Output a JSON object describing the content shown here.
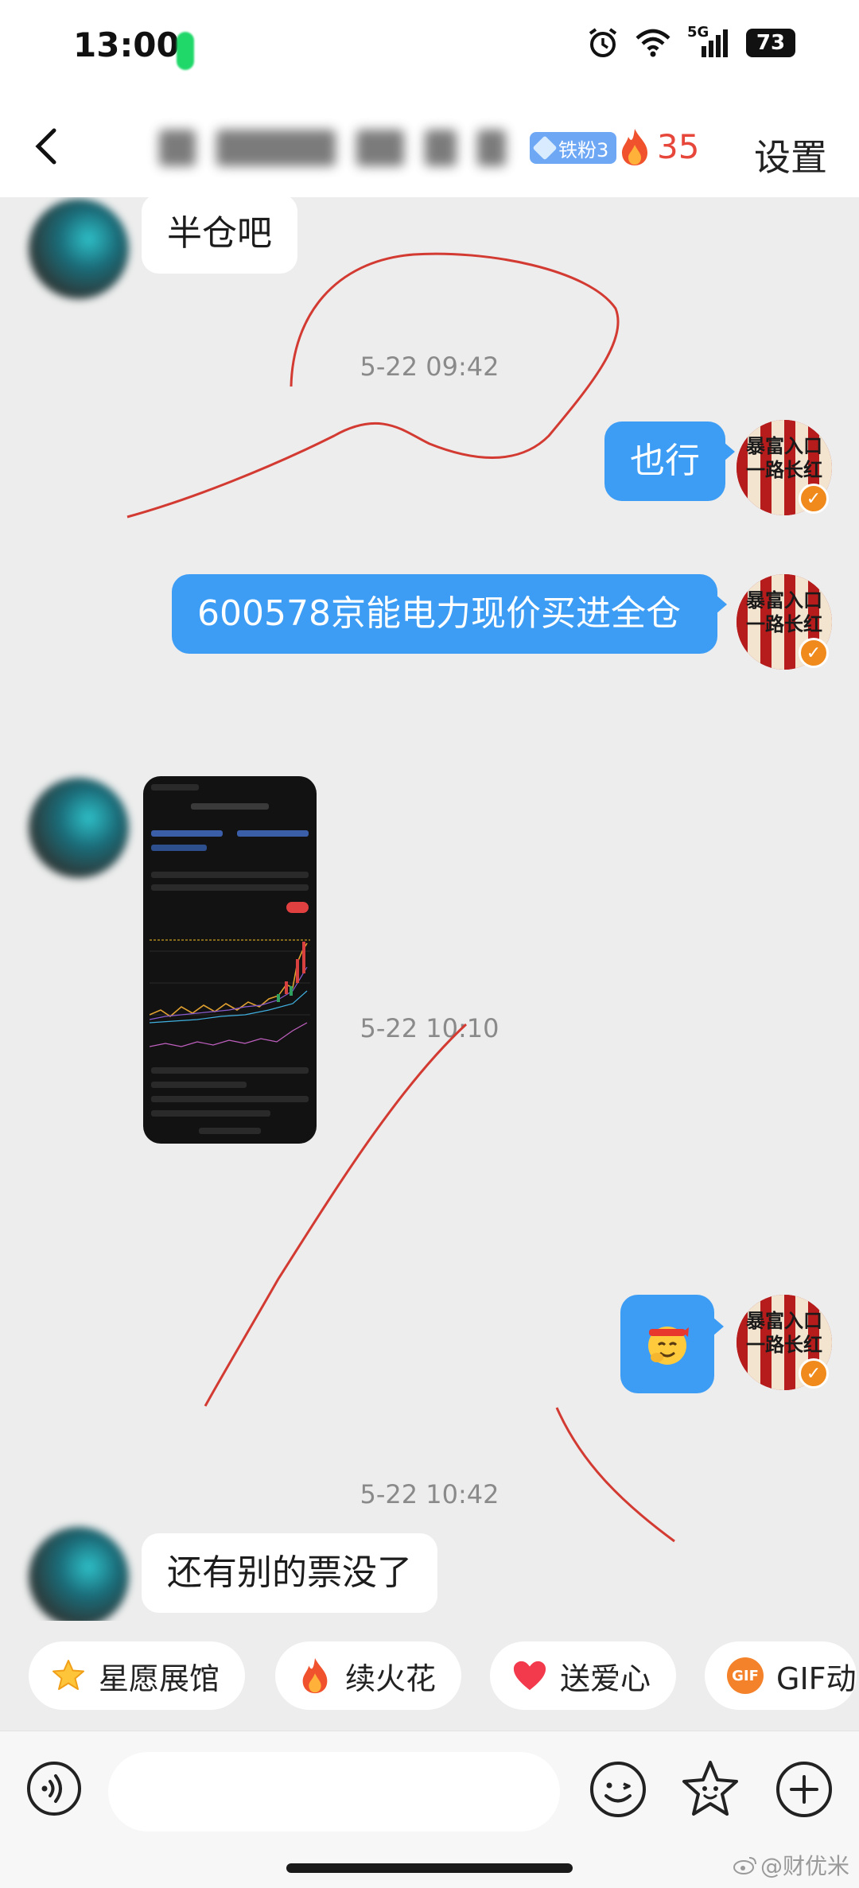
{
  "status_bar": {
    "time": "13:00",
    "network": "5G",
    "battery": "73"
  },
  "header": {
    "fan_badge": "铁粉3",
    "fire_count": "35",
    "settings_label": "设置"
  },
  "messages": {
    "m1": "半仓吧",
    "t1": "5-22 09:42",
    "m2": "也行",
    "m3": "600578京能电力现价买进全仓",
    "t2": "5-22 10:10",
    "t3": "5-22 10:42",
    "m4": "还有别的票没了"
  },
  "avatar_text": {
    "line1": "暴富入口",
    "line2": "一路长红"
  },
  "quick_actions": [
    "星愿展馆",
    "续火花",
    "送爱心",
    "GIF动"
  ],
  "input": {
    "placeholder": ""
  },
  "watermark": "@财优米",
  "colors": {
    "bubble_blue": "#3d9df5",
    "accent_red": "#e6473a",
    "annotation_red": "#d23a32"
  }
}
